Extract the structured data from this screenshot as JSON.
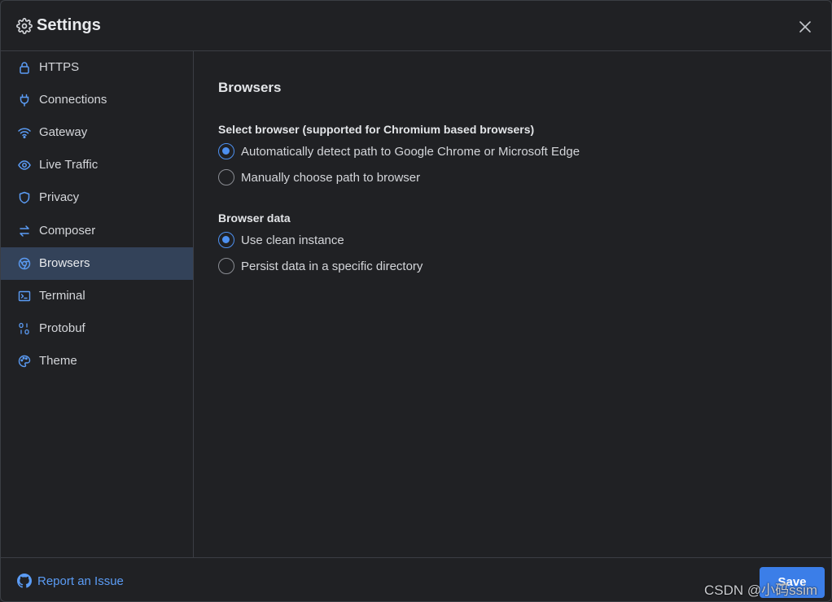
{
  "header": {
    "title": "Settings"
  },
  "sidebar": {
    "items": [
      {
        "label": "HTTPS",
        "icon": "lock-icon"
      },
      {
        "label": "Connections",
        "icon": "plug-icon"
      },
      {
        "label": "Gateway",
        "icon": "wifi-icon"
      },
      {
        "label": "Live Traffic",
        "icon": "eye-icon"
      },
      {
        "label": "Privacy",
        "icon": "shield-icon"
      },
      {
        "label": "Composer",
        "icon": "arrows-exchange-icon"
      },
      {
        "label": "Browsers",
        "icon": "chrome-icon",
        "active": true
      },
      {
        "label": "Terminal",
        "icon": "terminal-icon"
      },
      {
        "label": "Protobuf",
        "icon": "binary-icon"
      },
      {
        "label": "Theme",
        "icon": "palette-icon"
      }
    ]
  },
  "main": {
    "section_title": "Browsers",
    "select_browser": {
      "label": "Select browser (supported for Chromium based browsers)",
      "options": [
        {
          "label": "Automatically detect path to Google Chrome or Microsoft Edge",
          "checked": true
        },
        {
          "label": "Manually choose path to browser",
          "checked": false
        }
      ]
    },
    "browser_data": {
      "label": "Browser data",
      "options": [
        {
          "label": "Use clean instance",
          "checked": true
        },
        {
          "label": "Persist data in a specific directory",
          "checked": false
        }
      ]
    }
  },
  "footer": {
    "report_label": "Report an Issue",
    "save_label": "Save"
  },
  "watermark": "CSDN @小码ssim",
  "colors": {
    "accent": "#4d90f0",
    "active_nav_bg": "#334259",
    "background": "#202124",
    "icon_blue": "#5b9cf5"
  }
}
